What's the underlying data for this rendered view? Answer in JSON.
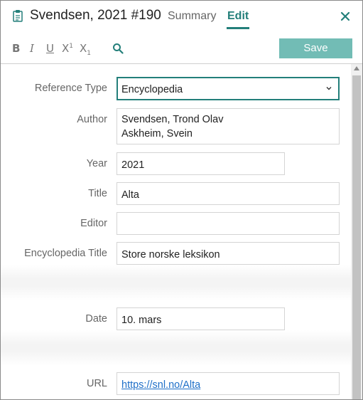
{
  "header": {
    "title": "Svendsen, 2021 #190",
    "tabs": [
      {
        "label": "Summary",
        "active": false
      },
      {
        "label": "Edit",
        "active": true
      }
    ],
    "accent_color": "#237f7a",
    "icons": {
      "document": "clipboard-icon",
      "close": "close-icon"
    }
  },
  "toolbar": {
    "bold": "B",
    "italic": "I",
    "underline": "U",
    "superscript": "X",
    "superscript_mark": "1",
    "subscript": "X",
    "subscript_mark": "1",
    "search_icon": "search-icon",
    "save_label": "Save",
    "save_color": "#72bcb5"
  },
  "form": {
    "reference_type": {
      "label": "Reference Type",
      "value": "Encyclopedia"
    },
    "author": {
      "label": "Author",
      "lines": [
        "Svendsen, Trond Olav",
        "Askheim, Svein"
      ]
    },
    "year": {
      "label": "Year",
      "value": "2021"
    },
    "title": {
      "label": "Title",
      "value": "Alta"
    },
    "editor": {
      "label": "Editor",
      "value": ""
    },
    "encyclopedia_title": {
      "label": "Encyclopedia Title",
      "value": "Store norske leksikon"
    },
    "date": {
      "label": "Date",
      "value": "10. mars"
    },
    "url": {
      "label": "URL",
      "value": "https://snl.no/Alta",
      "link_color": "#1e6fc8"
    }
  }
}
